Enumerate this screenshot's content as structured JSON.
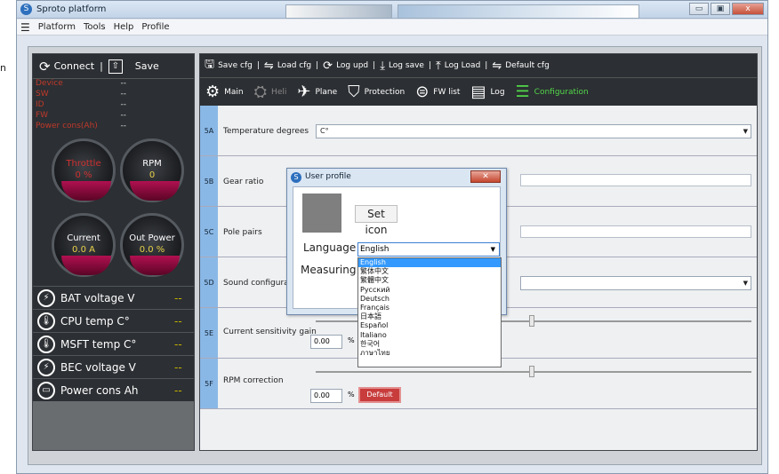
{
  "external": {
    "letter": "n"
  },
  "window": {
    "title": "Sproto platform",
    "minimize": "▭",
    "maximize": "▣",
    "close": "x"
  },
  "menu": [
    "Platform",
    "Tools",
    "Help",
    "Profile"
  ],
  "left_panel": {
    "connect": "Connect",
    "save": "Save",
    "status": [
      {
        "key": "Device",
        "value": "--"
      },
      {
        "key": "SW",
        "value": "--"
      },
      {
        "key": "ID",
        "value": "--"
      },
      {
        "key": "FW",
        "value": "--"
      },
      {
        "key": "Power cons(Ah)",
        "value": "--"
      }
    ],
    "gauges": [
      {
        "label": "Throttle",
        "value": "0 %"
      },
      {
        "label": "RPM",
        "value": "0"
      },
      {
        "label": "Current",
        "value": "0.0 A"
      },
      {
        "label": "Out Power",
        "value": "0.0 %"
      }
    ],
    "sensors": [
      {
        "label": "BAT voltage  V",
        "value": "--",
        "icon": "lightning-icon"
      },
      {
        "label": "CPU temp  C°",
        "value": "--",
        "icon": "cpu-thermometer-icon"
      },
      {
        "label": "MSFT temp  C°",
        "value": "--",
        "icon": "thermometer-icon"
      },
      {
        "label": "BEC voltage  V",
        "value": "--",
        "icon": "bec-icon"
      },
      {
        "label": "Power cons  Ah",
        "value": "--",
        "icon": "battery-icon"
      }
    ]
  },
  "toolbar1": [
    "Save cfg",
    "Load cfg",
    "Log upd",
    "Log save",
    "Log Load",
    "Default cfg"
  ],
  "toolbar2": [
    "Main",
    "Heli",
    "Plane",
    "Protection",
    "FW list",
    "Log",
    "Configuration"
  ],
  "rows": {
    "r5a": {
      "num": "5A",
      "label": "Temperature degrees",
      "value": "C°"
    },
    "r5b": {
      "num": "5B",
      "label": "Gear ratio"
    },
    "r5c": {
      "num": "5C",
      "label": "Pole pairs"
    },
    "r5d": {
      "num": "5D",
      "label": "Sound configura"
    },
    "r5e": {
      "num": "5E",
      "label": "Current sensitivity gain",
      "value": "0.00",
      "unit": "%"
    },
    "r5f": {
      "num": "5F",
      "label": "RPM correction",
      "value": "0.00",
      "unit": "%",
      "button": "Default"
    }
  },
  "dialog": {
    "title": "User profile",
    "set_icon": "Set icon",
    "language_label": "Language",
    "measuring_label": "Measuring",
    "language_value": "English",
    "options": [
      "English",
      "繁体中文",
      "繁體中文",
      "Русский",
      "Deutsch",
      "Français",
      "日本語",
      "Español",
      "Italiano",
      "한국어",
      "ภาษาไทย"
    ]
  }
}
